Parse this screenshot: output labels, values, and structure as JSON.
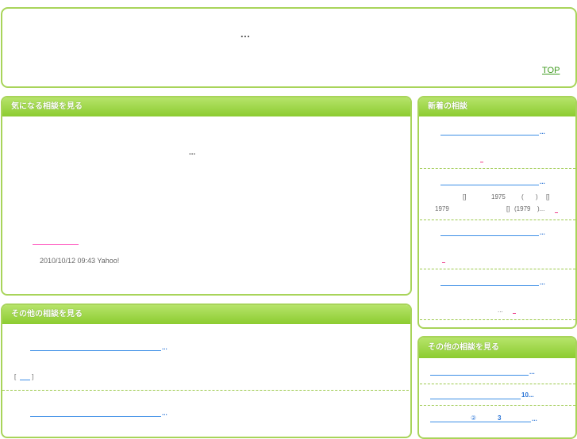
{
  "header": {
    "ellipsis": "...",
    "top_link": "TOP"
  },
  "featured": {
    "title": "気になる相談を見る",
    "ellipsis": "...",
    "meta": "2010/10/12 09:43 Yahoo!"
  },
  "others_main": {
    "title": "その他の相談を見る",
    "items": [
      {
        "ellipsis": "...",
        "bracket_open": "[",
        "bracket_close": "]"
      },
      {
        "ellipsis": "..."
      }
    ]
  },
  "newest": {
    "title": "新着の相談",
    "items": [
      {
        "ellipsis": "..."
      },
      {
        "ellipsis": "...",
        "snippet_line1": [
          "[]",
          "1975",
          "(",
          ")",
          "[]"
        ],
        "snippet_line2": [
          "1979",
          "[]",
          "(1979",
          ")..."
        ]
      },
      {
        "ellipsis": "..."
      },
      {
        "ellipsis": "...",
        "snippet": "..."
      }
    ]
  },
  "others_side": {
    "title": "その他の相談を見る",
    "items": [
      {
        "ellipsis": "..."
      },
      {
        "text": "10..."
      },
      {
        "circled": "②",
        "number": "3",
        "ellipsis": "..."
      }
    ]
  }
}
